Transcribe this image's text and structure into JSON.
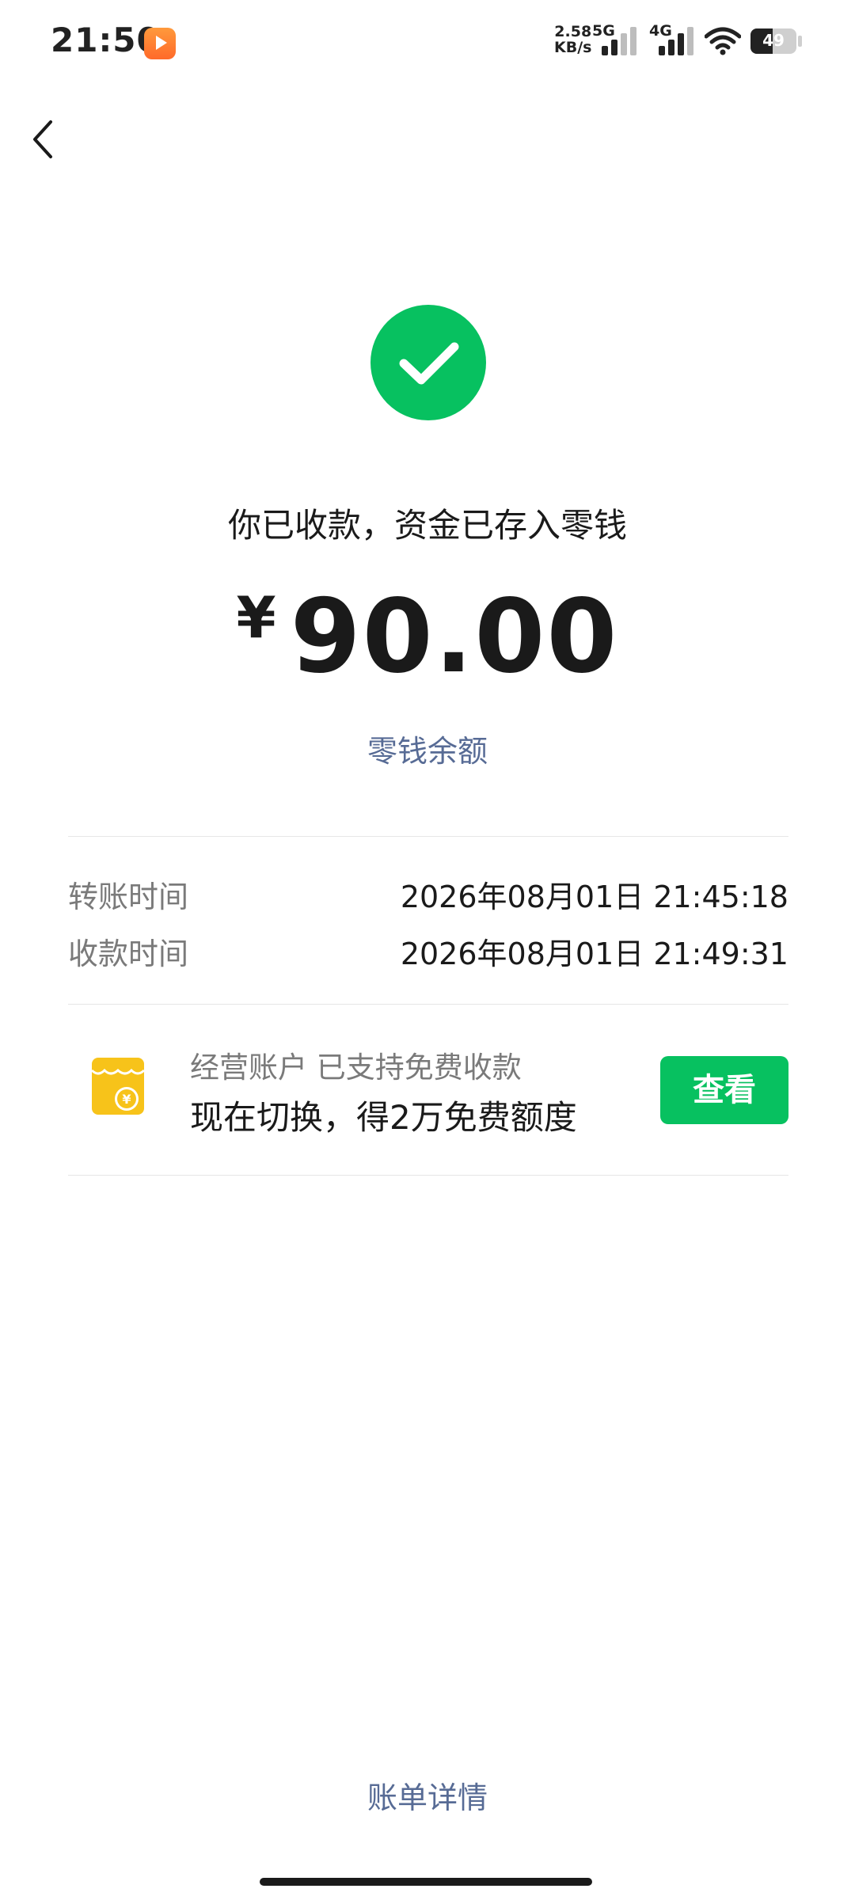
{
  "status_bar": {
    "time": "21:50",
    "net_speed_value": "2.58",
    "net_speed_unit": "KB/s",
    "sim1_label": "5G",
    "sim2_label": "4G",
    "battery": "49",
    "battery_level": 0.49
  },
  "result": {
    "headline": "你已收款，资金已存入零钱",
    "currency_symbol": "¥",
    "amount": "90.00",
    "balance_link": "零钱余额"
  },
  "details": [
    {
      "label": "转账时间",
      "value": "2026年08月01日 21:45:18"
    },
    {
      "label": "收款时间",
      "value": "2026年08月01日 21:49:31"
    }
  ],
  "promo": {
    "subtitle": "经营账户 已支持免费收款",
    "title": "现在切换，得2万免费额度",
    "button_label": "查看",
    "icon": "shop-yuan-icon"
  },
  "footer": {
    "bill_detail_link": "账单详情"
  },
  "colors": {
    "brand_green": "#07c160",
    "link_blue": "#576b95",
    "promo_yellow": "#f7c31a"
  },
  "icons": {
    "back": "back-chevron-icon",
    "success": "checkmark-circle-icon",
    "wifi": "wifi-icon",
    "battery": "battery-icon"
  }
}
